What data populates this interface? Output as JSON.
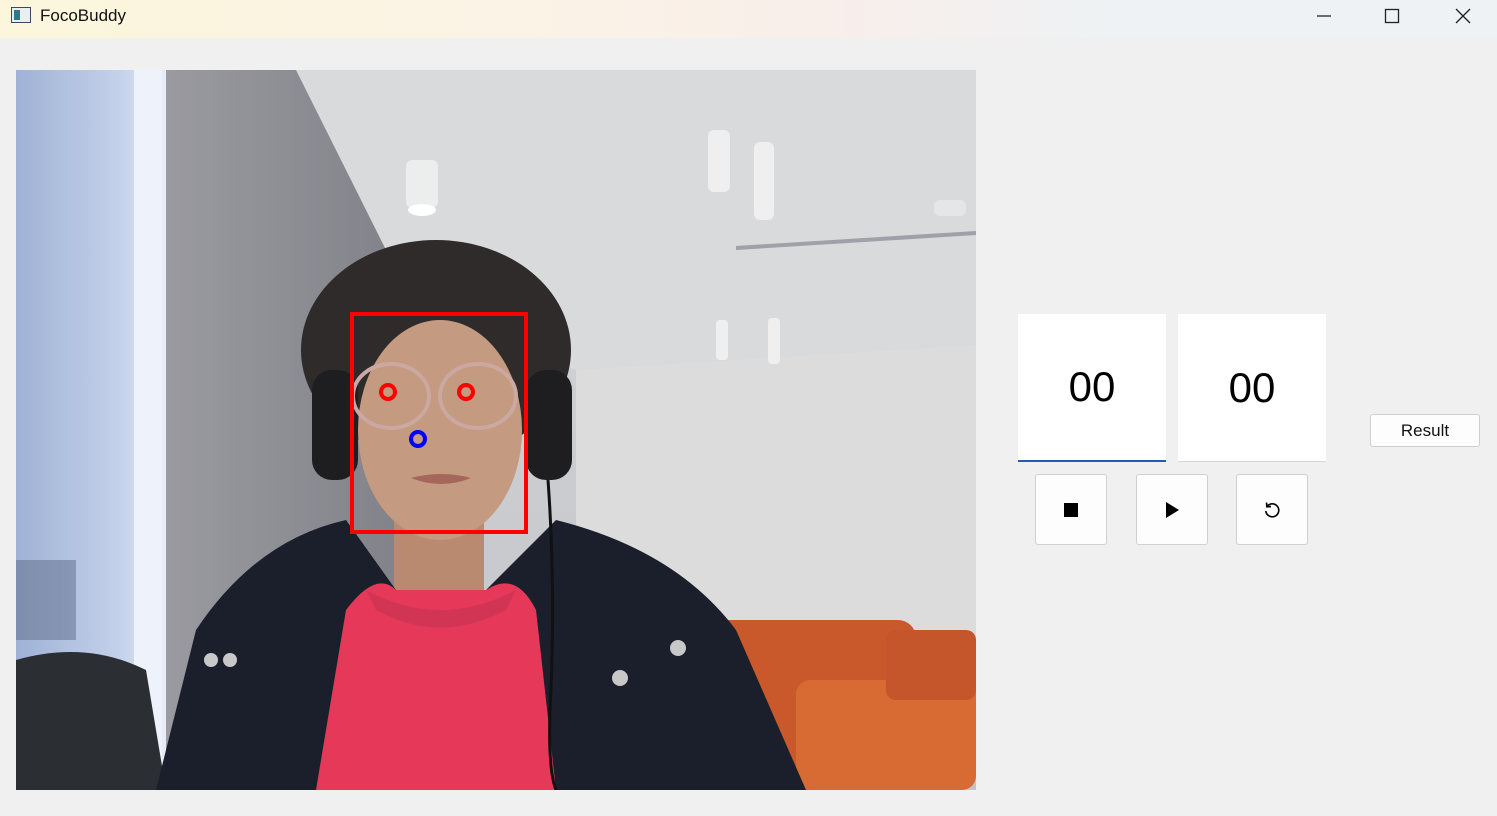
{
  "window": {
    "title": "FocoBuddy",
    "controls": [
      "minimize-icon",
      "maximize-icon",
      "close-icon"
    ]
  },
  "camera": {
    "overlay_colors": {
      "face_box": "#ff0000",
      "eye_markers": "#ff0000",
      "nose_marker": "#0000ff"
    }
  },
  "timer": {
    "minutes": "00",
    "seconds": "00"
  },
  "controls": {
    "stop_icon": "stop-icon",
    "play_icon": "play-icon",
    "reset_icon": "reset-icon",
    "result_label": "Result"
  },
  "colors": {
    "accent": "#1a5fb4",
    "background": "#f0f0f0"
  }
}
